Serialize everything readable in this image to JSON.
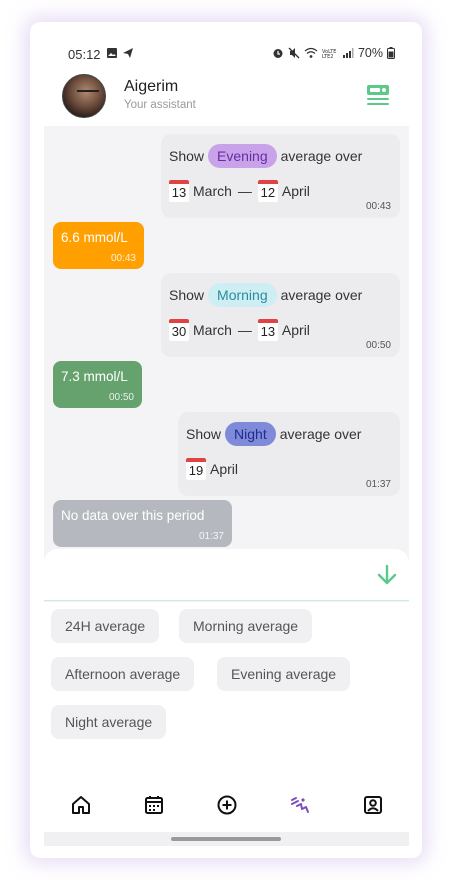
{
  "status_bar": {
    "time": "05:12",
    "battery": "70%"
  },
  "header": {
    "name": "Aigerim",
    "subtitle": "Your assistant"
  },
  "messages": [
    {
      "type": "query",
      "prefix": "Show",
      "period": "Evening",
      "suffix": "average over",
      "from_day": "13",
      "from_month": "March",
      "separator": "—",
      "to_day": "12",
      "to_month": "April",
      "time": "00:43"
    },
    {
      "type": "reply",
      "text": "6.6 mmol/L",
      "time": "00:43",
      "color": "#FFA000"
    },
    {
      "type": "query",
      "prefix": "Show",
      "period": "Morning",
      "suffix": "average over",
      "from_day": "30",
      "from_month": "March",
      "separator": "—",
      "to_day": "13",
      "to_month": "April",
      "time": "00:50"
    },
    {
      "type": "reply",
      "text": "7.3 mmol/L",
      "time": "00:50",
      "color": "#66A26E"
    },
    {
      "type": "query",
      "prefix": "Show",
      "period": "Night",
      "suffix": "average over",
      "from_day": "19",
      "from_month": "April",
      "time": "01:37"
    },
    {
      "type": "reply",
      "text": "No data over this period",
      "time": "01:37",
      "color": "#B5B9BF"
    }
  ],
  "quick_replies": [
    "24H average",
    "Morning average",
    "Afternoon average",
    "Evening average",
    "Night average"
  ],
  "nav": {
    "items": [
      "home-icon",
      "calendar-icon",
      "add-icon",
      "assistant-icon",
      "profile-icon"
    ],
    "active": "assistant-icon"
  },
  "colors": {
    "accent_green": "#5CC98A",
    "active_nav": "#7C4DBE"
  }
}
